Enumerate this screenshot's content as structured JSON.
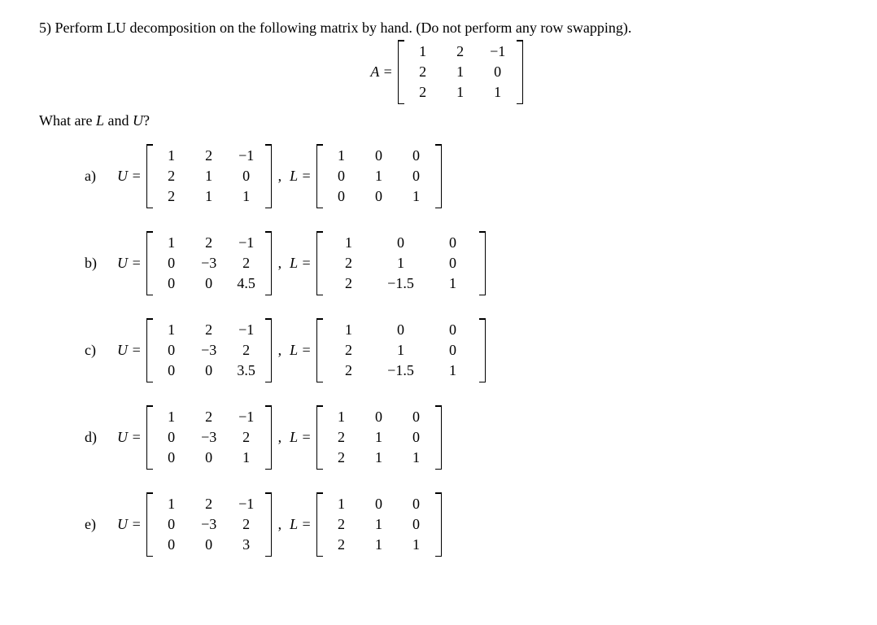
{
  "question_number": "5)",
  "question_text": "Perform LU decomposition on the following matrix by hand. (Do not perform any row swapping).",
  "A_label": "A =",
  "A": [
    [
      "1",
      "2",
      "−1"
    ],
    [
      "2",
      "1",
      "0"
    ],
    [
      "2",
      "1",
      "1"
    ]
  ],
  "subquestion": "What are",
  "subq_L": "L",
  "subq_and": "and",
  "subq_U": "U",
  "subq_q": "?",
  "opt_labels": {
    "a": "a)",
    "b": "b)",
    "c": "c)",
    "d": "d)",
    "e": "e)"
  },
  "U_eq": "U =",
  "L_eq": "L =",
  "comma": ",",
  "options": {
    "a": {
      "U": [
        [
          "1",
          "2",
          "−1"
        ],
        [
          "2",
          "1",
          "0"
        ],
        [
          "2",
          "1",
          "1"
        ]
      ],
      "L": [
        [
          "1",
          "0",
          "0"
        ],
        [
          "0",
          "1",
          "0"
        ],
        [
          "0",
          "0",
          "1"
        ]
      ]
    },
    "b": {
      "U": [
        [
          "1",
          "2",
          "−1"
        ],
        [
          "0",
          "−3",
          "2"
        ],
        [
          "0",
          "0",
          "4.5"
        ]
      ],
      "L": [
        [
          "1",
          "0",
          "0"
        ],
        [
          "2",
          "1",
          "0"
        ],
        [
          "2",
          "−1.5",
          "1"
        ]
      ]
    },
    "c": {
      "U": [
        [
          "1",
          "2",
          "−1"
        ],
        [
          "0",
          "−3",
          "2"
        ],
        [
          "0",
          "0",
          "3.5"
        ]
      ],
      "L": [
        [
          "1",
          "0",
          "0"
        ],
        [
          "2",
          "1",
          "0"
        ],
        [
          "2",
          "−1.5",
          "1"
        ]
      ]
    },
    "d": {
      "U": [
        [
          "1",
          "2",
          "−1"
        ],
        [
          "0",
          "−3",
          "2"
        ],
        [
          "0",
          "0",
          "1"
        ]
      ],
      "L": [
        [
          "1",
          "0",
          "0"
        ],
        [
          "2",
          "1",
          "0"
        ],
        [
          "2",
          "1",
          "1"
        ]
      ]
    },
    "e": {
      "U": [
        [
          "1",
          "2",
          "−1"
        ],
        [
          "0",
          "−3",
          "2"
        ],
        [
          "0",
          "0",
          "3"
        ]
      ],
      "L": [
        [
          "1",
          "0",
          "0"
        ],
        [
          "2",
          "1",
          "0"
        ],
        [
          "2",
          "1",
          "1"
        ]
      ]
    }
  }
}
